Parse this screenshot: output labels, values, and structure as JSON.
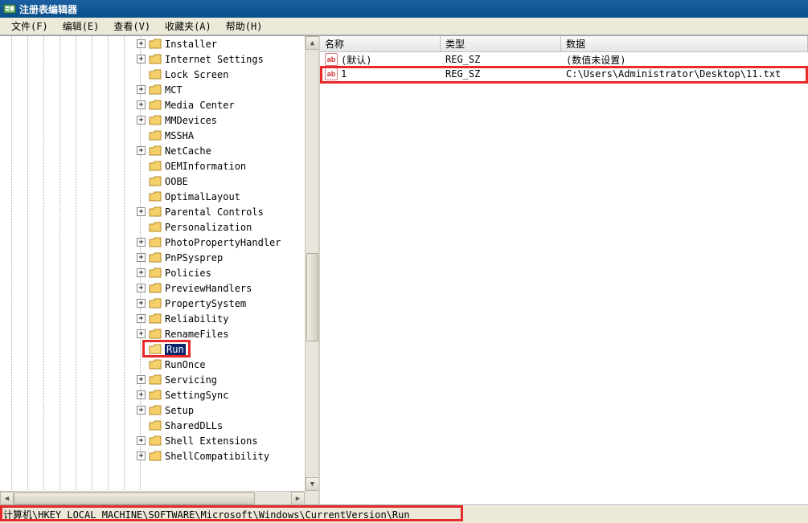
{
  "window": {
    "title": "注册表编辑器"
  },
  "menu": {
    "file": "文件(F)",
    "edit": "编辑(E)",
    "view": "查看(V)",
    "favorites": "收藏夹(A)",
    "help": "帮助(H)"
  },
  "tree": {
    "items": [
      {
        "label": "Installer",
        "exp": true
      },
      {
        "label": "Internet Settings",
        "exp": true
      },
      {
        "label": "Lock Screen",
        "exp": false
      },
      {
        "label": "MCT",
        "exp": true
      },
      {
        "label": "Media Center",
        "exp": true
      },
      {
        "label": "MMDevices",
        "exp": true
      },
      {
        "label": "MSSHA",
        "exp": false
      },
      {
        "label": "NetCache",
        "exp": true
      },
      {
        "label": "OEMInformation",
        "exp": false
      },
      {
        "label": "OOBE",
        "exp": false
      },
      {
        "label": "OptimalLayout",
        "exp": false
      },
      {
        "label": "Parental Controls",
        "exp": true
      },
      {
        "label": "Personalization",
        "exp": false
      },
      {
        "label": "PhotoPropertyHandler",
        "exp": true
      },
      {
        "label": "PnPSysprep",
        "exp": true
      },
      {
        "label": "Policies",
        "exp": true
      },
      {
        "label": "PreviewHandlers",
        "exp": true
      },
      {
        "label": "PropertySystem",
        "exp": true
      },
      {
        "label": "Reliability",
        "exp": true
      },
      {
        "label": "RenameFiles",
        "exp": true
      },
      {
        "label": "Run",
        "exp": false,
        "selected": true
      },
      {
        "label": "RunOnce",
        "exp": false
      },
      {
        "label": "Servicing",
        "exp": true
      },
      {
        "label": "SettingSync",
        "exp": true
      },
      {
        "label": "Setup",
        "exp": true
      },
      {
        "label": "SharedDLLs",
        "exp": false
      },
      {
        "label": "Shell Extensions",
        "exp": true
      },
      {
        "label": "ShellCompatibility",
        "exp": true
      }
    ]
  },
  "list": {
    "columns": {
      "name": "名称",
      "type": "类型",
      "data": "数据"
    },
    "rows": [
      {
        "name": "(默认)",
        "type": "REG_SZ",
        "data": "(数值未设置)"
      },
      {
        "name": "1",
        "type": "REG_SZ",
        "data": "C:\\Users\\Administrator\\Desktop\\11.txt"
      }
    ]
  },
  "status": {
    "path": "计算机\\HKEY_LOCAL_MACHINE\\SOFTWARE\\Microsoft\\Windows\\CurrentVersion\\Run"
  }
}
